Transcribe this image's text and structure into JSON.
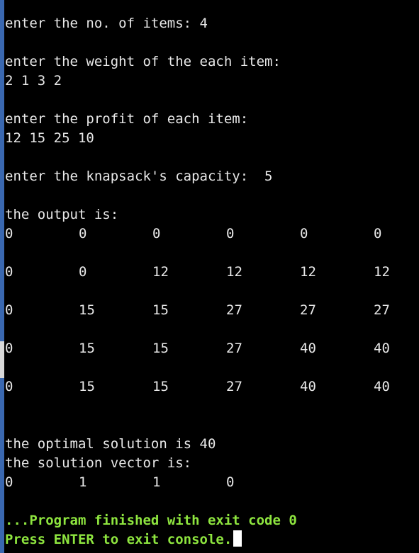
{
  "console": {
    "prompt_items": "enter the no. of items: 4",
    "prompt_weight": "enter the weight of the each item:",
    "weights": "2 1 3 2",
    "prompt_profit": "enter the profit of each item:",
    "profits": "12 15 25 10",
    "prompt_capacity": "enter the knapsack's capacity:  5",
    "output_label": "the output is:",
    "table": [
      [
        "0",
        "0",
        "0",
        "0",
        "0",
        "0"
      ],
      [
        "0",
        "0",
        "12",
        "12",
        "12",
        "12"
      ],
      [
        "0",
        "15",
        "15",
        "27",
        "27",
        "27"
      ],
      [
        "0",
        "15",
        "15",
        "27",
        "40",
        "40"
      ],
      [
        "0",
        "15",
        "15",
        "27",
        "40",
        "40"
      ]
    ],
    "optimal_solution": "the optimal solution is 40",
    "solution_vector_label": "the solution vector is:",
    "solution_vector": [
      "0",
      "1",
      "1",
      "0"
    ],
    "finish_message": "...Program finished with exit code 0",
    "exit_prompt": "Press ENTER to exit console."
  },
  "colors": {
    "background": "#000000",
    "text": "#e8e8e8",
    "finish_text": "#8ee53f",
    "left_edge": "#3a68b0"
  }
}
